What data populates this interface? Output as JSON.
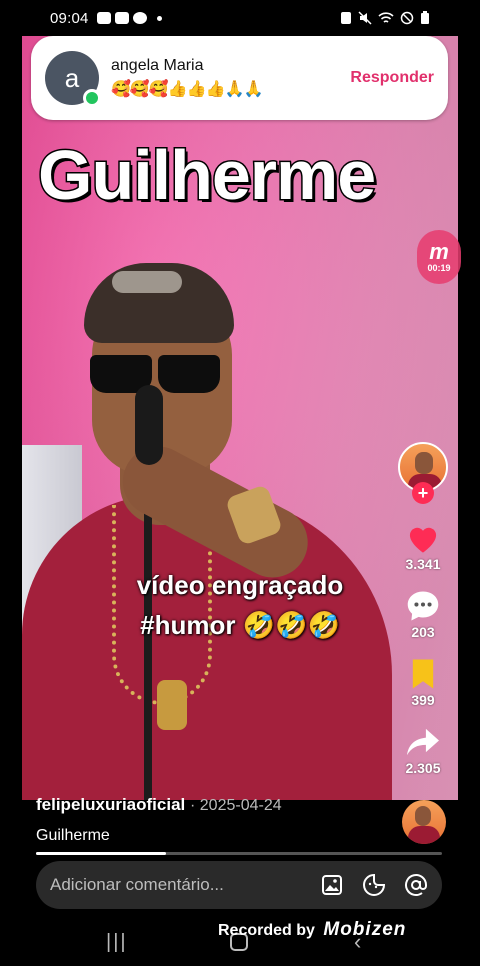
{
  "status_bar": {
    "time": "09:04"
  },
  "notification": {
    "avatar_letter": "a",
    "name": "angela Maria",
    "message": "🥰🥰🥰👍👍👍🙏🙏",
    "reply_label": "Responder"
  },
  "video": {
    "title_overlay": "Guilherme",
    "caption_line1": "vídeo engraçado",
    "caption_line2": "#humor 🤣🤣🤣",
    "watermark_time": "00:19",
    "progress": 0.32
  },
  "rail": {
    "likes": "3.341",
    "comments": "203",
    "saves": "399",
    "shares": "2.305"
  },
  "post": {
    "username": "felipeluxuriaoficial",
    "date": "· 2025-04-24",
    "description": "Guilherme"
  },
  "comment_bar": {
    "placeholder": "Adicionar comentário..."
  },
  "recorder": {
    "label": "Recorded by",
    "brand": "Mobizen"
  },
  "colors": {
    "accent": "#fe2c55",
    "reply": "#e1306c",
    "save": "#f7c219"
  }
}
